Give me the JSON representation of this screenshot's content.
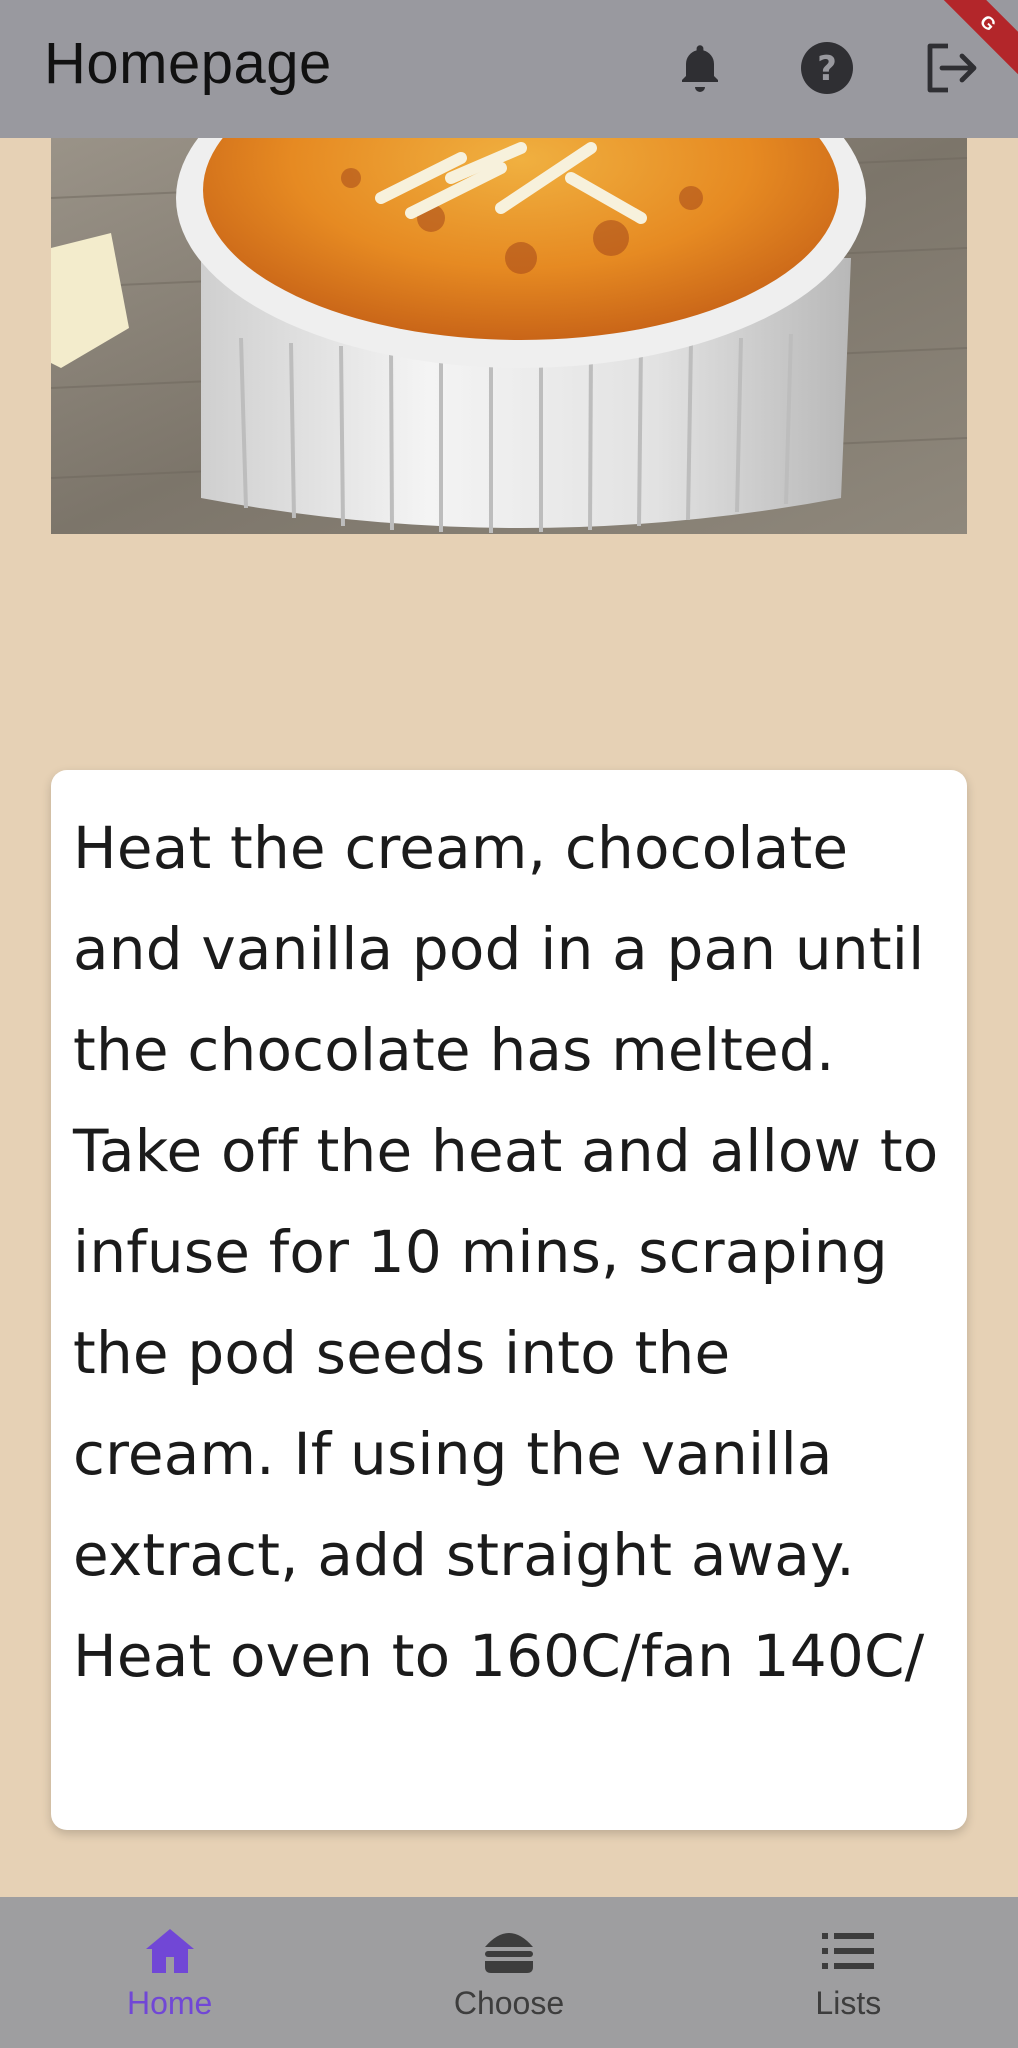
{
  "appbar": {
    "title": "Homepage",
    "icons": [
      "bell-icon",
      "help-icon",
      "logout-icon"
    ],
    "ribbon": "G"
  },
  "hero": {
    "alt": "Crème brûlée dessert with white chocolate shavings"
  },
  "card": {
    "text": "Heat the cream, chocolate and vanilla pod in a pan until the chocolate has melted. Take off the heat and allow to infuse for 10 mins, scraping the pod seeds into the cream. If using the vanilla extract, add straight away. Heat oven to 160C/fan 140C/"
  },
  "bottom_nav": {
    "items": [
      {
        "label": "Home",
        "icon": "home-icon",
        "active": true
      },
      {
        "label": "Choose",
        "icon": "burger-icon",
        "active": false
      },
      {
        "label": "Lists",
        "icon": "list-icon",
        "active": false
      }
    ]
  },
  "colors": {
    "background": "#e6d1b5",
    "appbar": "#99999f",
    "bottom_nav": "#9e9ea0",
    "active": "#7147d6"
  }
}
